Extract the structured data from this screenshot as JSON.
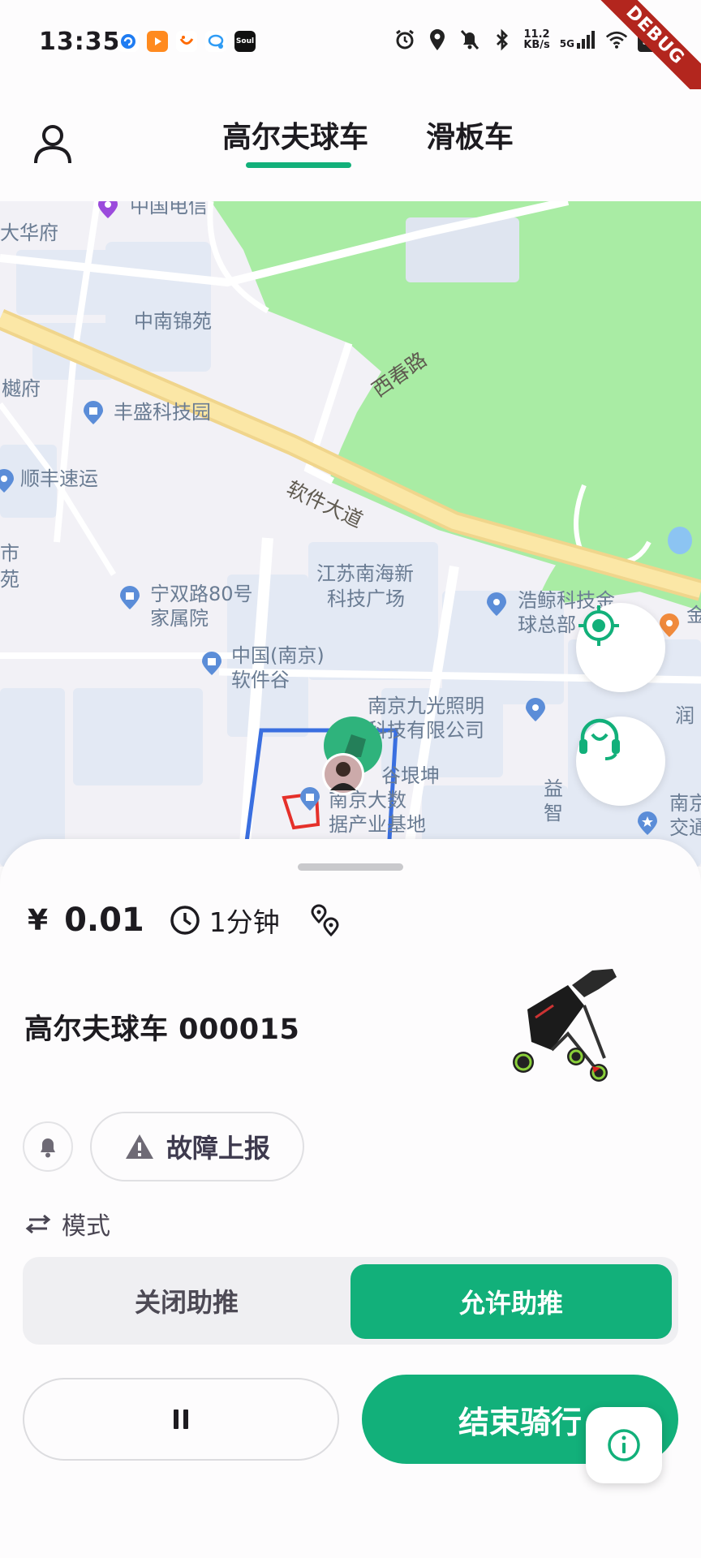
{
  "status_bar": {
    "time": "13:35",
    "speed_value": "11.2",
    "speed_unit": "KB/s",
    "network": "5G",
    "battery": "5",
    "debug_label": "DEBUG",
    "app_icons": [
      "app-blue-icon",
      "video-app-icon",
      "taobao-icon",
      "qq-icon",
      "soul-icon"
    ],
    "soul_label": "Soul"
  },
  "header": {
    "tabs": [
      {
        "label": "高尔夫球车",
        "active": true
      },
      {
        "label": "滑板车",
        "active": false
      }
    ],
    "accent": "#12b07a"
  },
  "map": {
    "labels": [
      {
        "text": "中国电信"
      },
      {
        "text": "大华府"
      },
      {
        "text": "中南锦苑"
      },
      {
        "text": "樾府"
      },
      {
        "text": "丰盛科技园"
      },
      {
        "text": "西春路"
      },
      {
        "text": "顺丰速运"
      },
      {
        "text": "软件大道"
      },
      {
        "text": "江苏南海新"
      },
      {
        "text": "科技广场"
      },
      {
        "text": "浩鲸科技金"
      },
      {
        "text": "球总部"
      },
      {
        "text": "宁双路80号"
      },
      {
        "text": "家属院"
      },
      {
        "text": "中国(南京)"
      },
      {
        "text": "软件谷"
      },
      {
        "text": "南京九光照明"
      },
      {
        "text": "科技有限公司"
      },
      {
        "text": "谷垠坤"
      },
      {
        "text": "南京大数"
      },
      {
        "text": "据产业基地"
      },
      {
        "text": "益"
      },
      {
        "text": "智"
      },
      {
        "text": "南京"
      },
      {
        "text": "交通"
      },
      {
        "text": "润"
      },
      {
        "text": "市"
      },
      {
        "text": "苑"
      },
      {
        "text": "金"
      }
    ]
  },
  "sheet": {
    "currency": "¥",
    "price": "0.01",
    "duration": "1分钟",
    "vehicle_name": "高尔夫球车 000015",
    "fault_label": "故障上报",
    "mode_label": "模式",
    "assist_off_label": "关闭助推",
    "assist_on_label": "允许助推",
    "assist_enabled": true,
    "end_ride_label": "结束骑行"
  }
}
